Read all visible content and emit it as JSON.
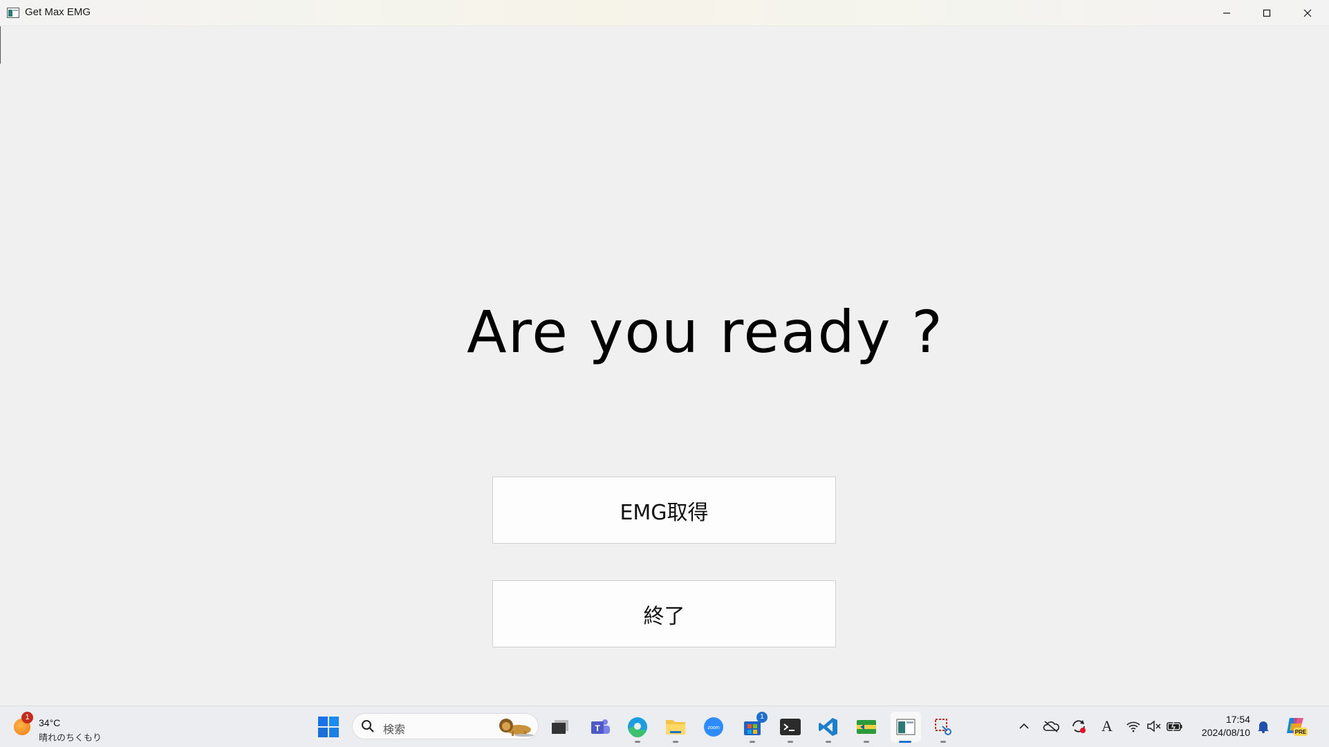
{
  "window": {
    "title": "Get Max EMG",
    "icon": "app-window-icon",
    "controls": [
      "minimize-icon",
      "maximize-icon",
      "close-icon"
    ]
  },
  "main": {
    "heading": "Are you ready ?",
    "buttons": {
      "emg": "EMG取得",
      "exit": "終了"
    }
  },
  "taskbar": {
    "weather": {
      "temperature": "34°C",
      "condition": "晴れのちくもり",
      "badge": "1"
    },
    "search": {
      "placeholder": "検索"
    },
    "apps": [
      {
        "name": "start-icon"
      },
      {
        "name": "task-view-icon"
      },
      {
        "name": "teams-icon"
      },
      {
        "name": "edge-icon"
      },
      {
        "name": "file-explorer-icon"
      },
      {
        "name": "zoom-icon",
        "label": "zoom"
      },
      {
        "name": "store-icon",
        "badge": "1"
      },
      {
        "name": "terminal-icon"
      },
      {
        "name": "vscode-icon"
      },
      {
        "name": "app-green-icon"
      },
      {
        "name": "app-window-icon"
      },
      {
        "name": "snipping-tool-icon"
      }
    ],
    "tray": {
      "icons": [
        "chevron-up-icon",
        "onedrive-off-icon",
        "sync-icon",
        "ime-icon",
        "wifi-icon",
        "volume-muted-icon",
        "battery-icon",
        "bell-icon",
        "copilot-icon"
      ],
      "ime_label": "A",
      "copilot_label": "PRE",
      "time": "17:54",
      "date": "2024/08/10"
    }
  }
}
